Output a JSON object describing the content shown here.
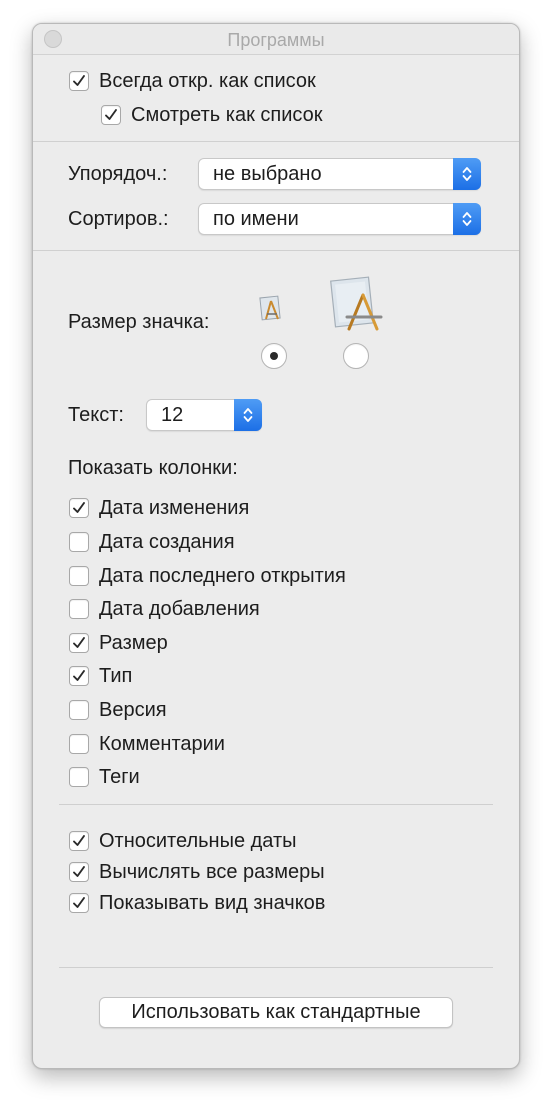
{
  "window": {
    "title": "Программы"
  },
  "view_options": {
    "always_list": {
      "label": "Всегда откр. как список",
      "checked": true
    },
    "browse_list": {
      "label": "Смотреть как список",
      "checked": true
    }
  },
  "arrange": {
    "label": "Упорядоч.:",
    "value": "не выбрано"
  },
  "sort": {
    "label": "Сортиров.:",
    "value": "по имени"
  },
  "icon_size": {
    "label": "Размер значка:",
    "selected": "small",
    "options": [
      "small",
      "large"
    ]
  },
  "text_size": {
    "label": "Текст:",
    "value": "12"
  },
  "columns": {
    "heading": "Показать колонки:",
    "items": [
      {
        "label": "Дата изменения",
        "checked": true
      },
      {
        "label": "Дата создания",
        "checked": false
      },
      {
        "label": "Дата последнего открытия",
        "checked": false
      },
      {
        "label": "Дата добавления",
        "checked": false
      },
      {
        "label": "Размер",
        "checked": true
      },
      {
        "label": "Тип",
        "checked": true
      },
      {
        "label": "Версия",
        "checked": false
      },
      {
        "label": "Комментарии",
        "checked": false
      },
      {
        "label": "Теги",
        "checked": false
      }
    ]
  },
  "extra_options": [
    {
      "label": "Относительные даты",
      "checked": true
    },
    {
      "label": "Вычислять все размеры",
      "checked": true
    },
    {
      "label": "Показывать вид значков",
      "checked": true
    }
  ],
  "default_button": {
    "label": "Использовать как стандартные"
  },
  "colors": {
    "accent": "#1c6fe6",
    "window_bg": "#ececec"
  },
  "icons": {
    "check": "checkmark-icon",
    "stepper": "updown-arrows-icon",
    "app": "applications-folder-icon"
  }
}
